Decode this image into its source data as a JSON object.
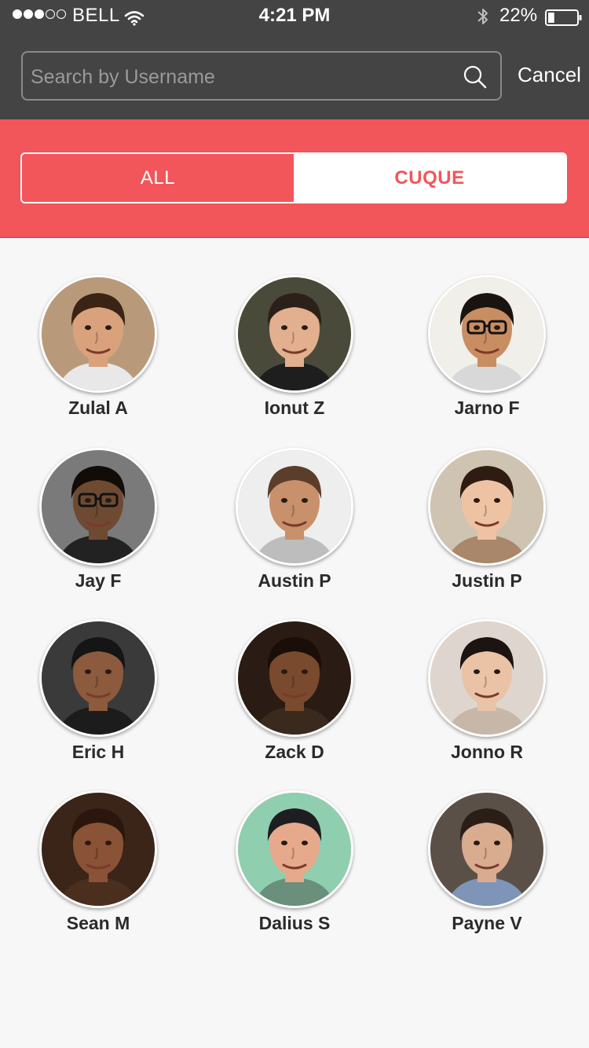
{
  "status_bar": {
    "carrier": "BELL",
    "time": "4:21 PM",
    "battery_percent": "22%",
    "signal_bars_filled": 3,
    "signal_bars_total": 5,
    "battery_level": 0.22,
    "icons": [
      "wifi-icon",
      "bluetooth-icon",
      "battery-icon"
    ]
  },
  "search": {
    "placeholder": "Search by Username",
    "value": "",
    "icon": "search-icon",
    "cancel_label": "Cancel"
  },
  "tabs": [
    {
      "label": "ALL",
      "active": true
    },
    {
      "label": "CUQUE",
      "active": false
    }
  ],
  "colors": {
    "header_bg": "#444444",
    "accent": "#f2555a",
    "page_bg": "#f7f7f7"
  },
  "users": [
    {
      "name": "Zulal A"
    },
    {
      "name": "Ionut Z"
    },
    {
      "name": "Jarno F"
    },
    {
      "name": "Jay F"
    },
    {
      "name": "Austin P"
    },
    {
      "name": "Justin P"
    },
    {
      "name": "Eric H"
    },
    {
      "name": "Zack D"
    },
    {
      "name": "Jonno R"
    },
    {
      "name": "Sean M"
    },
    {
      "name": "Dalius S"
    },
    {
      "name": "Payne V"
    }
  ]
}
